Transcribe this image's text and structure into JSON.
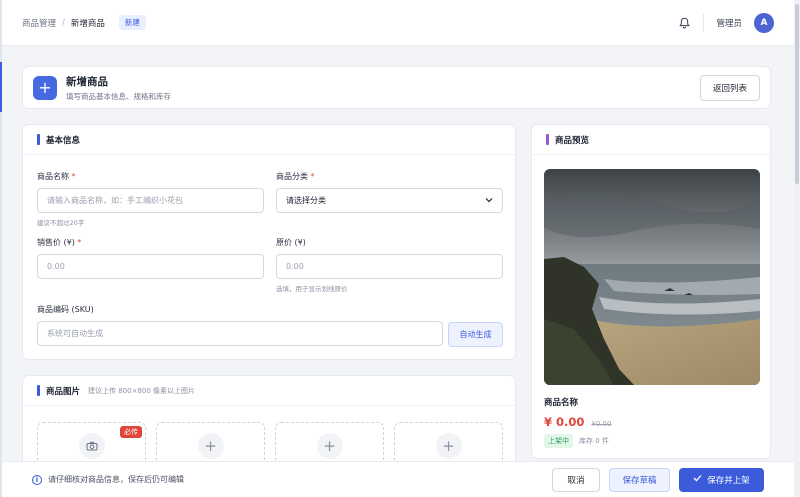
{
  "breadcrumb": {
    "parent": "商品管理",
    "current": "新增商品",
    "badge": "新建"
  },
  "topbar": {
    "bell_icon": "bell-icon",
    "user_name": "管理员",
    "avatar_letter": "A"
  },
  "header": {
    "title": "新增商品",
    "subtitle": "填写商品基本信息、规格和库存",
    "back_label": "返回列表"
  },
  "basic": {
    "title": "基本信息",
    "name": {
      "label": "商品名称",
      "placeholder": "请输入商品名称，如：手工编织小花包",
      "help": "建议不超过20字"
    },
    "category": {
      "label": "商品分类",
      "selected": "请选择分类"
    },
    "price": {
      "label": "销售价 (¥)",
      "placeholder": "0.00"
    },
    "original": {
      "label": "原价 (¥)",
      "placeholder": "0.00",
      "help": "选填，用于显示划线原价"
    },
    "sku": {
      "label": "商品编码 (SKU)",
      "placeholder": "系统可自动生成",
      "auto_label": "自动生成"
    },
    "required_mark": "*"
  },
  "images": {
    "title": "商品图片",
    "hint": "建议上传 800×800 像素以上图片",
    "required_tag": "必传"
  },
  "preview": {
    "title": "商品预览",
    "name": "商品名称",
    "price": "¥ 0.00",
    "original_price": "¥0.00",
    "status": "上架中",
    "stock": "库存 0 件"
  },
  "footer": {
    "info_icon": "info-icon",
    "text": "请仔细核对商品信息，保存后仍可编辑",
    "cancel_label": "取消",
    "draft_label": "保存草稿",
    "save_label": "保存并上架"
  },
  "colors": {
    "primary": "#3b5bdb",
    "danger": "#e0453a",
    "success": "#2f9e5a",
    "preview_bar": "#9b59d0"
  }
}
